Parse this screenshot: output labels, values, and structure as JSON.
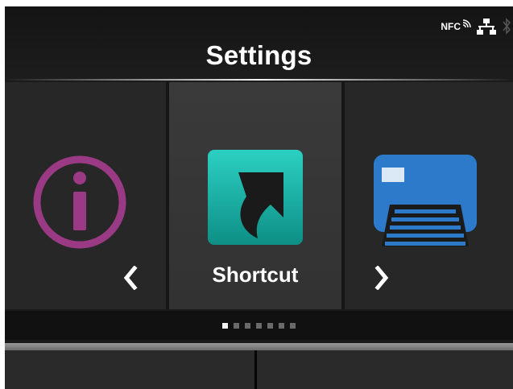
{
  "header": {
    "title": "Settings",
    "status_icons": {
      "nfc_label": "NFC",
      "icons": [
        "nfc-icon",
        "network-icon",
        "bluetooth-icon"
      ]
    }
  },
  "carousel": {
    "items": [
      {
        "icon": "info-icon",
        "color": "#9b3a84"
      },
      {
        "label": "Shortcut",
        "icon": "shortcut-icon",
        "color": "#17b0a4"
      },
      {
        "icon": "printer-icon",
        "color": "#2c7ac9"
      }
    ],
    "selected_index": 1,
    "prev_icon": "chevron-left-icon",
    "next_icon": "chevron-right-icon"
  },
  "pager": {
    "page_count": 7,
    "current_page": 1
  },
  "colors": {
    "background": "#1b1b1b",
    "accent": "#17b0a4",
    "text": "#ffffff"
  }
}
